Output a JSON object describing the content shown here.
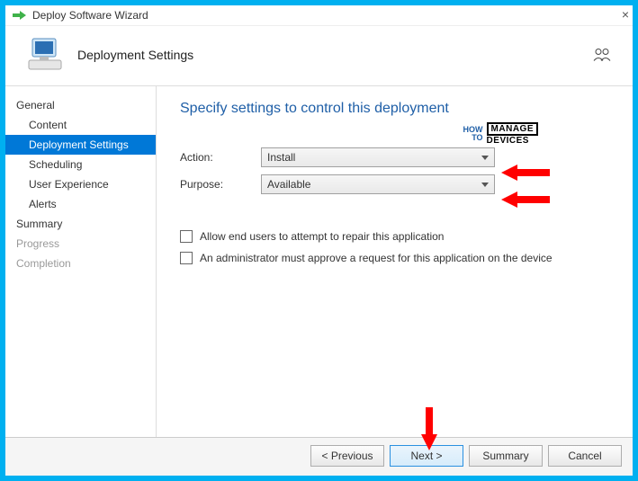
{
  "titlebar": {
    "title": "Deploy Software Wizard"
  },
  "header": {
    "subtitle": "Deployment Settings"
  },
  "sidebar": {
    "general": "General",
    "items": [
      {
        "label": "Content"
      },
      {
        "label": "Deployment Settings"
      },
      {
        "label": "Scheduling"
      },
      {
        "label": "User Experience"
      },
      {
        "label": "Alerts"
      }
    ],
    "summary": "Summary",
    "progress": "Progress",
    "completion": "Completion"
  },
  "main": {
    "heading": "Specify settings to control this deployment",
    "action_label": "Action:",
    "action_value": "Install",
    "purpose_label": "Purpose:",
    "purpose_value": "Available",
    "check1": "Allow end users to attempt to repair this application",
    "check2": "An administrator must approve a request for this application on the device"
  },
  "footer": {
    "previous": "< Previous",
    "next": "Next >",
    "summary": "Summary",
    "cancel": "Cancel"
  },
  "watermark": {
    "how": "HOW",
    "to": "TO",
    "manage": "MANAGE",
    "devices": "DEVICES"
  }
}
